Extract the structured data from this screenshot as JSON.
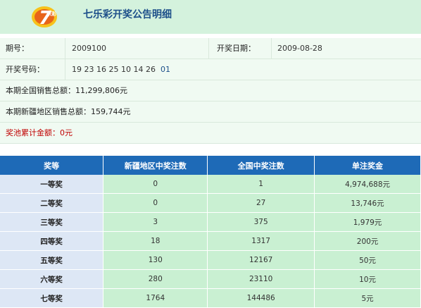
{
  "header": {
    "logo_text": "7乐彩",
    "title": "七乐彩开奖公告明细"
  },
  "info": {
    "issue_label": "期号：",
    "issue_value": "2009100",
    "date_label": "开奖日期：",
    "date_value": "2009-08-28",
    "numbers_label": "开奖号码：",
    "main_numbers": "19 23 16 25 10 14 26",
    "special_number": "01",
    "national_sales": "本期全国销售总额：11,299,806元",
    "xinjiang_sales": "本期新疆地区销售总额：159,744元",
    "jackpot": "奖池累计金额：0元"
  },
  "table": {
    "headers": [
      "奖等",
      "新疆地区中奖注数",
      "全国中奖注数",
      "单注奖金"
    ],
    "rows": [
      [
        "一等奖",
        "0",
        "1",
        "4,974,688元"
      ],
      [
        "二等奖",
        "0",
        "27",
        "13,746元"
      ],
      [
        "三等奖",
        "3",
        "375",
        "1,979元"
      ],
      [
        "四等奖",
        "18",
        "1317",
        "200元"
      ],
      [
        "五等奖",
        "130",
        "12167",
        "50元"
      ],
      [
        "六等奖",
        "280",
        "23110",
        "10元"
      ],
      [
        "七等奖",
        "1764",
        "144486",
        "5元"
      ]
    ]
  },
  "colors": {
    "header_bg": "#d4f2dd",
    "title": "#1d4f8a",
    "table_head": "#1e6ab7",
    "grade_col": "#dde7f5",
    "num_col": "#c9f0d2",
    "jackpot": "#c00000"
  }
}
